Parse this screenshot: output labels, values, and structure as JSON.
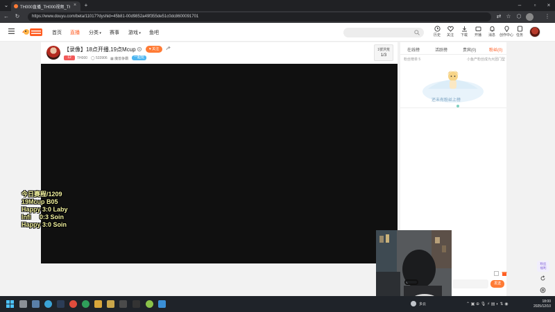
{
  "browser": {
    "tab_title": "TH000直播_TH000视频_TH000",
    "url": "https://www.douyu.com/beta/11017?dyshid=45b81-00d9852a49f355de51c0dc8600091701"
  },
  "header": {
    "nav": [
      "首页",
      "直播",
      "分类",
      "赛事",
      "游戏",
      "鱼吧"
    ],
    "buttons": [
      "历史",
      "关注",
      "下载",
      "开播",
      "消息",
      "创作中心",
      "任务"
    ]
  },
  "room": {
    "title": "【录像】18点开播,19点Mcup",
    "follow_label": "关注",
    "level": "12",
    "streamer": "TH000",
    "fans": "533906",
    "category": "魔兽争霸",
    "tag": "一起玩",
    "rank_label": "1號洪荒",
    "rank_value": "1/3"
  },
  "overlay": {
    "lines": [
      "今日赛程/1209",
      "19Mcup B05",
      "Happy 3:0 Laby",
      "Infi     0:3 Soin",
      "Happy 3:0 Soin"
    ]
  },
  "chat": {
    "tabs": [
      "在线榜",
      "活跃榜",
      "贵宾(0)",
      "粉丝(0)"
    ],
    "fans_label": "粉丝榜单",
    "fans_count": "5",
    "fans_tip": "小鱼产粉丝成为大团门型",
    "empty_text": "还未有粉丝上榜",
    "send_label": "发送"
  },
  "side_tools": {
    "promo": "粉丝\n福利"
  },
  "taskbar": {
    "tray_text": "多云",
    "time": "18:00",
    "date": "2025/12/10"
  },
  "colors": {
    "accent": "#ff5d23",
    "player_bg": "#101010",
    "overlay_text": "#f3f3a0"
  }
}
